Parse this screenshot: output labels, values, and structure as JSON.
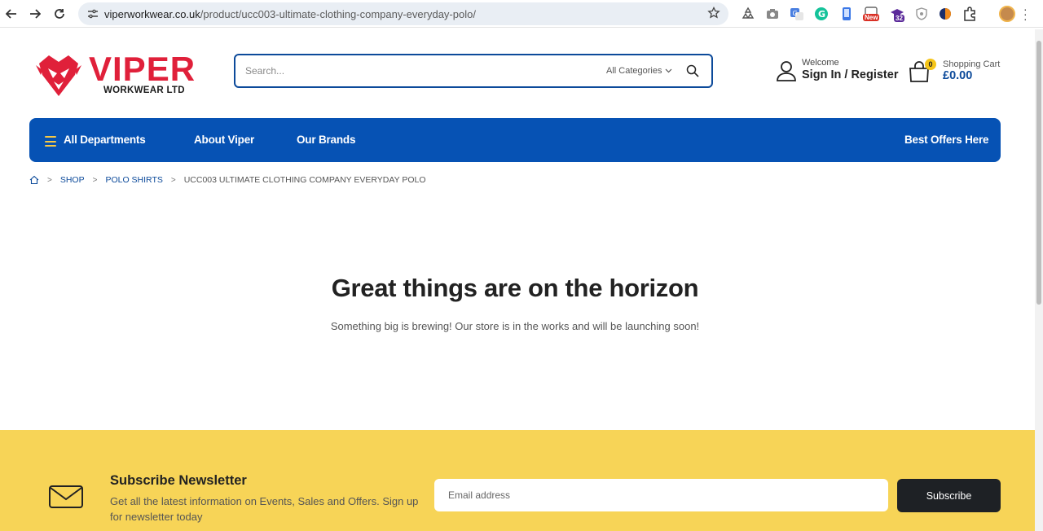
{
  "browser": {
    "url_domain": "viperworkwear.co.uk",
    "url_path": "/product/ucc003-ultimate-clothing-company-everyday-polo/",
    "new_badge": "New",
    "count_badge": "32"
  },
  "header": {
    "logo_text": "VIPER",
    "logo_subtext": "WORKWEAR LTD",
    "search_placeholder": "Search...",
    "search_category": "All Categories",
    "welcome": "Welcome",
    "sign_in": "Sign In",
    "slash": "/",
    "register": "Register",
    "cart_label": "Shopping Cart",
    "cart_amount": "£0.00",
    "cart_count": "0"
  },
  "nav": {
    "departments": "All Departments",
    "about": "About Viper",
    "brands": "Our Brands",
    "offers": "Best Offers Here"
  },
  "breadcrumb": {
    "shop": "SHOP",
    "category": "POLO SHIRTS",
    "current": "UCC003 ULTIMATE CLOTHING COMPANY EVERYDAY POLO"
  },
  "main": {
    "title": "Great things are on the horizon",
    "subtitle": "Something big is brewing! Our store is in the works and will be launching soon!"
  },
  "newsletter": {
    "title": "Subscribe Newsletter",
    "description": "Get all the latest information on Events, Sales and Offers. Sign up for newsletter today",
    "email_placeholder": "Email address",
    "button": "Subscribe"
  },
  "colors": {
    "brand_red": "#e0203a",
    "brand_blue": "#0652b4",
    "newsletter_yellow": "#f7d457",
    "accent_yellow": "#f7c945"
  }
}
